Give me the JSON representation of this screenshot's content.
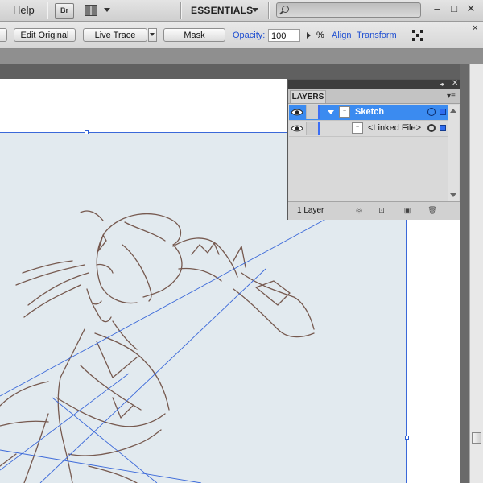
{
  "menubar": {
    "help_label": "Help",
    "bridge_label": "Br",
    "workspace_label": "ESSENTIALS",
    "search_placeholder": "",
    "window_buttons": {
      "minimize": "–",
      "restore": "□",
      "close": "✕"
    }
  },
  "control_bar": {
    "edit_original_label": "Edit Original",
    "live_trace_label": "Live Trace",
    "mask_label": "Mask",
    "opacity_label": "Opacity:",
    "opacity_value": "100",
    "percent_label": "%",
    "align_label": "Align",
    "transform_label": "Transform",
    "close_glyph": "✕"
  },
  "layers_panel": {
    "tab_label": "LAYERS",
    "collapse_glyph": "◂◂",
    "close_glyph": "✕",
    "menu_glyph": "▾≡",
    "rows": [
      {
        "name": "Sketch",
        "selected": true,
        "expanded": true
      },
      {
        "name": "<Linked File>",
        "selected": false
      }
    ],
    "footer_count": "1 Layer"
  },
  "colors": {
    "selection_blue": "#3a68d9",
    "layer_highlight": "#3b8bf0",
    "sketch_line": "#6b4a3e",
    "paper": "#e2eaef"
  },
  "icons": [
    "eye-icon",
    "search-icon",
    "bridge-icon",
    "arrange-documents-icon",
    "layer-thumbnail-icon",
    "target-circle-icon",
    "make-clipping-mask-icon",
    "new-sublayer-icon",
    "new-layer-icon",
    "delete-layer-icon"
  ]
}
